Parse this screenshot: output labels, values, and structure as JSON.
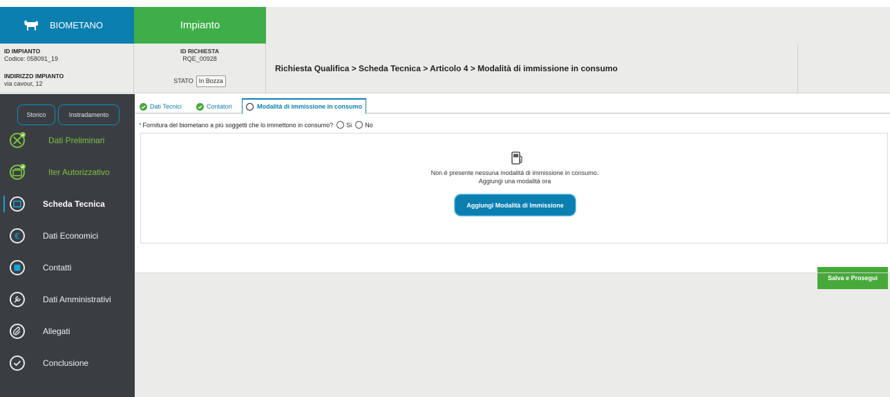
{
  "header": {
    "brand_label": "BIOMETANO",
    "active_tab_label": "Impianto"
  },
  "impianto": {
    "id_label": "ID IMPIANTO",
    "codice": "Codice: 058091_19",
    "indirizzo_label": "INDIRIZZO IMPIANTO",
    "indirizzo": "via cavour, 12"
  },
  "richiesta": {
    "id_label": "ID RICHIESTA",
    "id_value": "RQE_00928",
    "stato_label": "STATO",
    "stato_value": "In Bozza"
  },
  "breadcrumb": "Richiesta Qualifica > Scheda Tecnica > Articolo 4 > Modalità di immissione in consumo",
  "sidebar": {
    "buttons": [
      "Storico",
      "Instradamento"
    ],
    "items": [
      {
        "label": "Dati Preliminari",
        "icon": "tools-icon",
        "state": "done"
      },
      {
        "label": "Iter Autorizzativo",
        "icon": "briefcase-icon",
        "state": "done"
      },
      {
        "label": "Scheda Tecnica",
        "icon": "document-icon",
        "state": "active"
      },
      {
        "label": "Dati Economici",
        "icon": "euro-icon",
        "state": "normal"
      },
      {
        "label": "Contatti",
        "icon": "contacts-icon",
        "state": "normal"
      },
      {
        "label": "Dati Amministrativi",
        "icon": "wrench-icon",
        "state": "normal"
      },
      {
        "label": "Allegati",
        "icon": "paperclip-icon",
        "state": "normal"
      },
      {
        "label": "Conclusione",
        "icon": "check-circle-icon",
        "state": "normal"
      }
    ]
  },
  "tabs": [
    {
      "label": "Dati Tecnici",
      "state": "completed"
    },
    {
      "label": "Contatori",
      "state": "completed"
    },
    {
      "label": "Modalità di immissione in consumo",
      "state": "active"
    }
  ],
  "form": {
    "question_required_mark": "*",
    "question": "Fornitura del biometano a più soggetti che lo immettono in consumo?",
    "options": [
      "Si",
      "No"
    ]
  },
  "empty_state": {
    "icon": "fuel-pump-icon",
    "line1": "Non è presente nessuna modalità di immissione in consumo.",
    "line2": "Aggiungi una modalità ora",
    "add_button": "Aggiungi Modalità di Immissione"
  },
  "actions": {
    "save_button": "Salva e Prosegui"
  },
  "colors": {
    "brand_blue": "#0b7fb0",
    "accent_green": "#3fae49",
    "sidebar_bg": "#3a3e42",
    "done_green": "#7dc242"
  }
}
